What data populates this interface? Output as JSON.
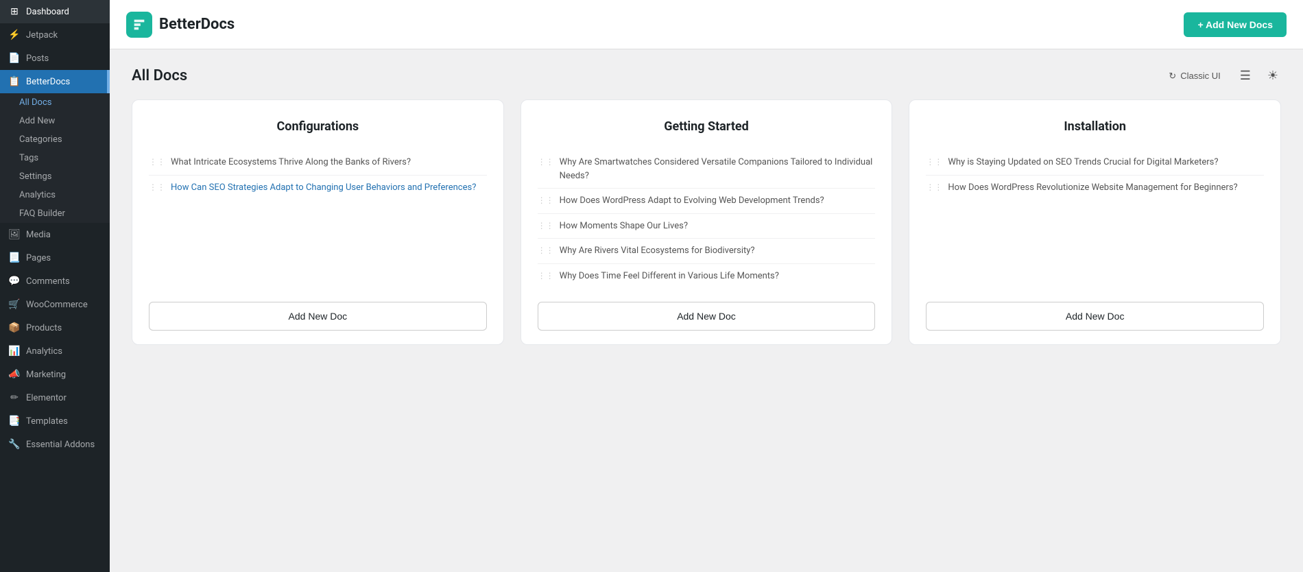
{
  "sidebar": {
    "items": [
      {
        "id": "dashboard",
        "label": "Dashboard",
        "icon": "⊞"
      },
      {
        "id": "jetpack",
        "label": "Jetpack",
        "icon": "⚡"
      },
      {
        "id": "posts",
        "label": "Posts",
        "icon": "📄"
      },
      {
        "id": "betterdocs",
        "label": "BetterDocs",
        "icon": "📋",
        "active": true
      }
    ],
    "betterdocs_submenu": [
      {
        "id": "all-docs",
        "label": "All Docs",
        "active": true
      },
      {
        "id": "add-new",
        "label": "Add New"
      },
      {
        "id": "categories",
        "label": "Categories"
      },
      {
        "id": "tags",
        "label": "Tags"
      },
      {
        "id": "settings",
        "label": "Settings"
      },
      {
        "id": "analytics",
        "label": "Analytics"
      },
      {
        "id": "faq-builder",
        "label": "FAQ Builder"
      }
    ],
    "bottom_items": [
      {
        "id": "media",
        "label": "Media",
        "icon": "🖼"
      },
      {
        "id": "pages",
        "label": "Pages",
        "icon": "📃"
      },
      {
        "id": "comments",
        "label": "Comments",
        "icon": "💬"
      },
      {
        "id": "woocommerce",
        "label": "WooCommerce",
        "icon": "🛒"
      },
      {
        "id": "products",
        "label": "Products",
        "icon": "📦"
      },
      {
        "id": "analytics2",
        "label": "Analytics",
        "icon": "📊"
      },
      {
        "id": "marketing",
        "label": "Marketing",
        "icon": "📣"
      },
      {
        "id": "elementor",
        "label": "Elementor",
        "icon": "✏"
      },
      {
        "id": "templates",
        "label": "Templates",
        "icon": "📑"
      },
      {
        "id": "essential-addons",
        "label": "Essential Addons",
        "icon": "🔧"
      }
    ]
  },
  "header": {
    "logo_text": "BetterDocs",
    "add_new_label": "+ Add New Docs"
  },
  "page": {
    "title": "All Docs",
    "classic_ui_label": "Classic UI",
    "menu_icon": "☰",
    "light_icon": "☀"
  },
  "cards": [
    {
      "id": "configurations",
      "title": "Configurations",
      "items": [
        {
          "text": "What Intricate Ecosystems Thrive Along the Banks of Rivers?",
          "is_link": false
        },
        {
          "text": "How Can SEO Strategies Adapt to Changing User Behaviors and Preferences?",
          "is_link": true
        }
      ],
      "add_doc_label": "Add New Doc"
    },
    {
      "id": "getting-started",
      "title": "Getting Started",
      "items": [
        {
          "text": "Why Are Smartwatches Considered Versatile Companions Tailored to Individual Needs?",
          "is_link": false
        },
        {
          "text": "How Does WordPress Adapt to Evolving Web Development Trends?",
          "is_link": false
        },
        {
          "text": "How Moments Shape Our Lives?",
          "is_link": false
        },
        {
          "text": "Why Are Rivers Vital Ecosystems for Biodiversity?",
          "is_link": false
        },
        {
          "text": "Why Does Time Feel Different in Various Life Moments?",
          "is_link": false
        }
      ],
      "add_doc_label": "Add New Doc"
    },
    {
      "id": "installation",
      "title": "Installation",
      "items": [
        {
          "text": "Why is Staying Updated on SEO Trends Crucial for Digital Marketers?",
          "is_link": false
        },
        {
          "text": "How Does WordPress Revolutionize Website Management for Beginners?",
          "is_link": false
        }
      ],
      "add_doc_label": "Add New Doc"
    }
  ]
}
